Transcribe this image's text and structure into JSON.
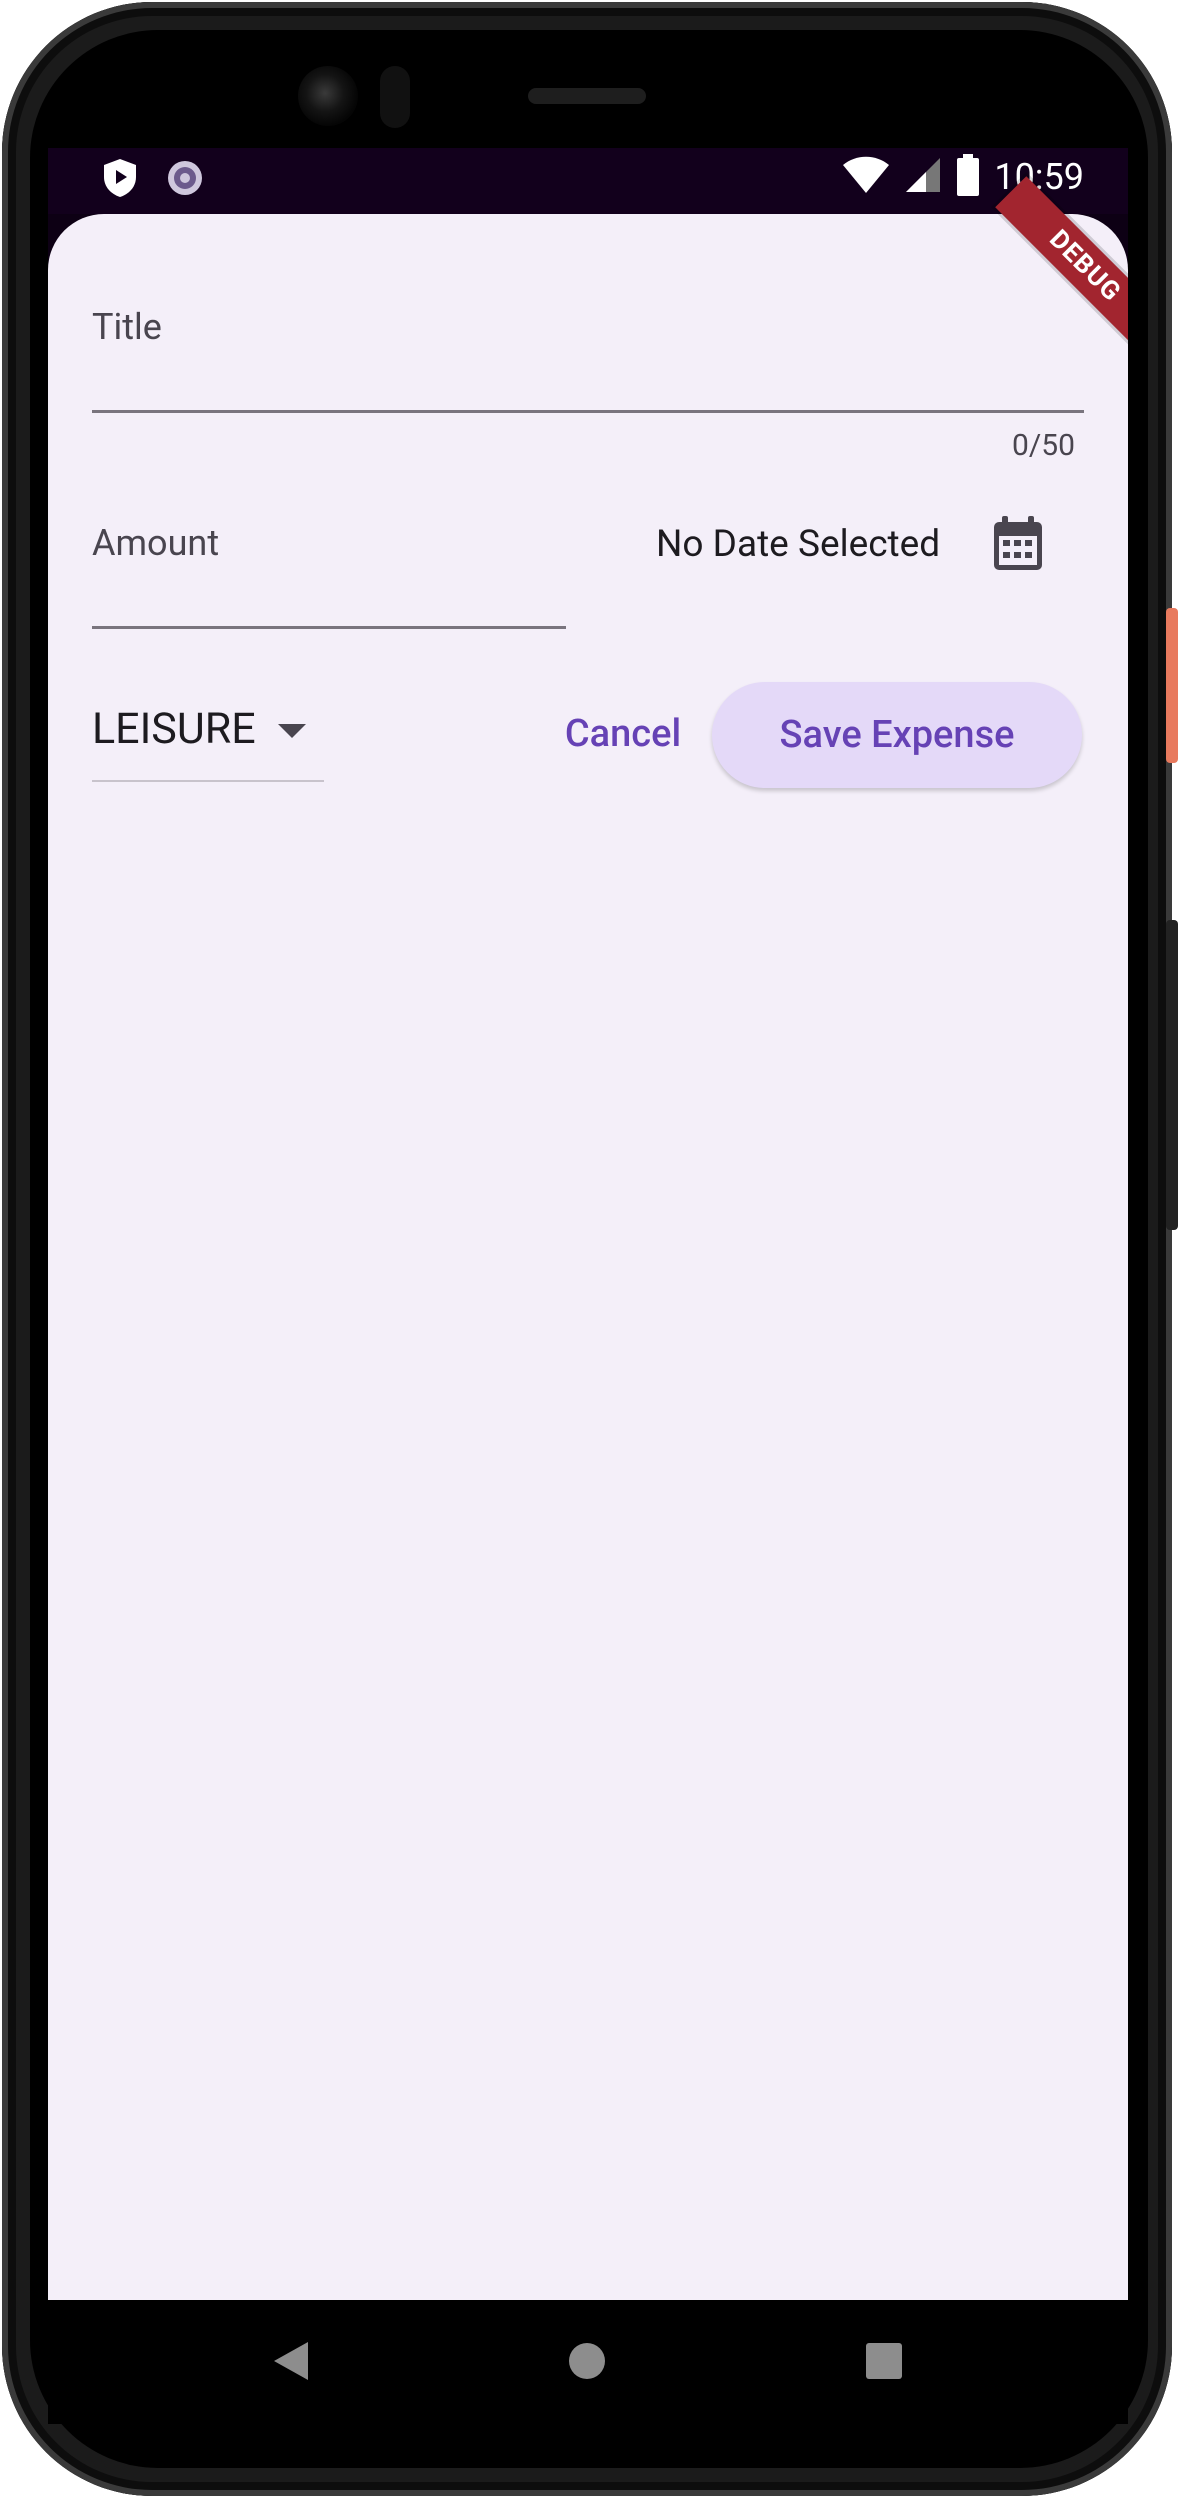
{
  "status_bar": {
    "time": "10:59",
    "left_icons": [
      "shield-icon",
      "loading-icon"
    ],
    "right_icons": [
      "wifi-icon",
      "signal-icon",
      "battery-icon"
    ]
  },
  "debug_banner": {
    "label": "DEBUG",
    "color": "#a2252f"
  },
  "form": {
    "title_field": {
      "label": "Title",
      "value": "",
      "counter": "0/50"
    },
    "amount_field": {
      "label": "Amount",
      "value": ""
    },
    "date": {
      "text": "No Date Selected",
      "icon": "calendar-icon"
    },
    "category": {
      "selected": "LEISURE"
    },
    "cancel_label": "Cancel",
    "save_label": "Save Expense"
  },
  "nav_bar": {
    "icons": [
      "back-icon",
      "home-icon",
      "recents-icon"
    ]
  },
  "colors": {
    "accent": "#6642b5",
    "sheet_background": "#f4eff9",
    "save_button_background": "#e4d9f8"
  }
}
